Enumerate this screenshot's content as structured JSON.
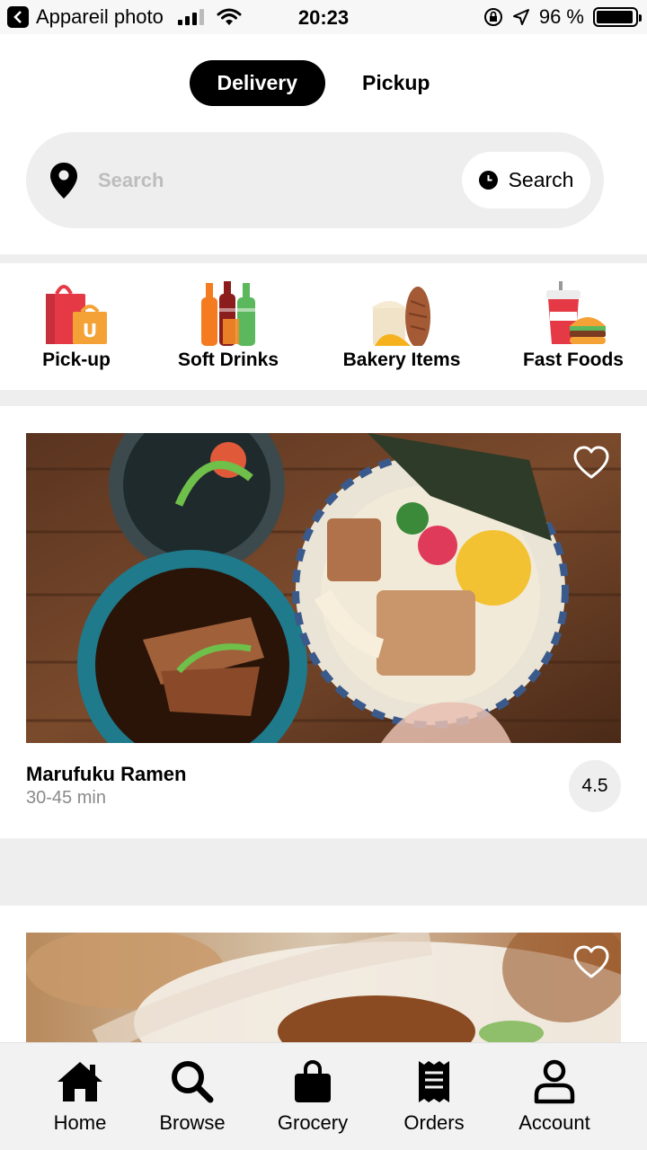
{
  "status_bar": {
    "back_app": "Appareil photo",
    "time": "20:23",
    "battery": "96 %",
    "battery_level": 0.96
  },
  "mode_toggle": {
    "delivery_label": "Delivery",
    "pickup_label": "Pickup",
    "selected": "Delivery"
  },
  "search": {
    "placeholder": "Search",
    "button_label": "Search"
  },
  "categories": [
    {
      "label": "Pick-up",
      "icon": "shopping-bags-icon"
    },
    {
      "label": "Soft Drinks",
      "icon": "soda-bottles-icon"
    },
    {
      "label": "Bakery Items",
      "icon": "bread-icon"
    },
    {
      "label": "Fast Foods",
      "icon": "burger-drink-icon"
    }
  ],
  "restaurants": [
    {
      "name": "Marufuku Ramen",
      "time": "30-45 min",
      "rating": "4.5",
      "image": "ramen-bowls-photo"
    },
    {
      "image": "fried-food-photo"
    }
  ],
  "tab_bar": {
    "items": [
      {
        "label": "Home",
        "icon": "home-icon"
      },
      {
        "label": "Browse",
        "icon": "search-icon"
      },
      {
        "label": "Grocery",
        "icon": "shopping-bag-icon"
      },
      {
        "label": "Orders",
        "icon": "receipt-icon"
      },
      {
        "label": "Account",
        "icon": "person-icon"
      }
    ]
  },
  "colors": {
    "accent": "#000000",
    "band": "#eeeeee",
    "muted_text": "#8a8a8a"
  }
}
